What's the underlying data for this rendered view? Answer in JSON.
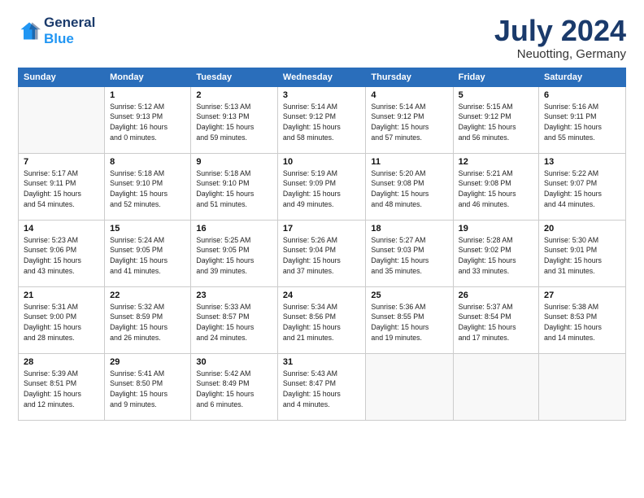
{
  "header": {
    "logo_line1": "General",
    "logo_line2": "Blue",
    "month": "July 2024",
    "location": "Neuotting, Germany"
  },
  "columns": [
    "Sunday",
    "Monday",
    "Tuesday",
    "Wednesday",
    "Thursday",
    "Friday",
    "Saturday"
  ],
  "weeks": [
    [
      {
        "day": "",
        "info": ""
      },
      {
        "day": "1",
        "info": "Sunrise: 5:12 AM\nSunset: 9:13 PM\nDaylight: 16 hours\nand 0 minutes."
      },
      {
        "day": "2",
        "info": "Sunrise: 5:13 AM\nSunset: 9:13 PM\nDaylight: 15 hours\nand 59 minutes."
      },
      {
        "day": "3",
        "info": "Sunrise: 5:14 AM\nSunset: 9:12 PM\nDaylight: 15 hours\nand 58 minutes."
      },
      {
        "day": "4",
        "info": "Sunrise: 5:14 AM\nSunset: 9:12 PM\nDaylight: 15 hours\nand 57 minutes."
      },
      {
        "day": "5",
        "info": "Sunrise: 5:15 AM\nSunset: 9:12 PM\nDaylight: 15 hours\nand 56 minutes."
      },
      {
        "day": "6",
        "info": "Sunrise: 5:16 AM\nSunset: 9:11 PM\nDaylight: 15 hours\nand 55 minutes."
      }
    ],
    [
      {
        "day": "7",
        "info": "Sunrise: 5:17 AM\nSunset: 9:11 PM\nDaylight: 15 hours\nand 54 minutes."
      },
      {
        "day": "8",
        "info": "Sunrise: 5:18 AM\nSunset: 9:10 PM\nDaylight: 15 hours\nand 52 minutes."
      },
      {
        "day": "9",
        "info": "Sunrise: 5:18 AM\nSunset: 9:10 PM\nDaylight: 15 hours\nand 51 minutes."
      },
      {
        "day": "10",
        "info": "Sunrise: 5:19 AM\nSunset: 9:09 PM\nDaylight: 15 hours\nand 49 minutes."
      },
      {
        "day": "11",
        "info": "Sunrise: 5:20 AM\nSunset: 9:08 PM\nDaylight: 15 hours\nand 48 minutes."
      },
      {
        "day": "12",
        "info": "Sunrise: 5:21 AM\nSunset: 9:08 PM\nDaylight: 15 hours\nand 46 minutes."
      },
      {
        "day": "13",
        "info": "Sunrise: 5:22 AM\nSunset: 9:07 PM\nDaylight: 15 hours\nand 44 minutes."
      }
    ],
    [
      {
        "day": "14",
        "info": "Sunrise: 5:23 AM\nSunset: 9:06 PM\nDaylight: 15 hours\nand 43 minutes."
      },
      {
        "day": "15",
        "info": "Sunrise: 5:24 AM\nSunset: 9:05 PM\nDaylight: 15 hours\nand 41 minutes."
      },
      {
        "day": "16",
        "info": "Sunrise: 5:25 AM\nSunset: 9:05 PM\nDaylight: 15 hours\nand 39 minutes."
      },
      {
        "day": "17",
        "info": "Sunrise: 5:26 AM\nSunset: 9:04 PM\nDaylight: 15 hours\nand 37 minutes."
      },
      {
        "day": "18",
        "info": "Sunrise: 5:27 AM\nSunset: 9:03 PM\nDaylight: 15 hours\nand 35 minutes."
      },
      {
        "day": "19",
        "info": "Sunrise: 5:28 AM\nSunset: 9:02 PM\nDaylight: 15 hours\nand 33 minutes."
      },
      {
        "day": "20",
        "info": "Sunrise: 5:30 AM\nSunset: 9:01 PM\nDaylight: 15 hours\nand 31 minutes."
      }
    ],
    [
      {
        "day": "21",
        "info": "Sunrise: 5:31 AM\nSunset: 9:00 PM\nDaylight: 15 hours\nand 28 minutes."
      },
      {
        "day": "22",
        "info": "Sunrise: 5:32 AM\nSunset: 8:59 PM\nDaylight: 15 hours\nand 26 minutes."
      },
      {
        "day": "23",
        "info": "Sunrise: 5:33 AM\nSunset: 8:57 PM\nDaylight: 15 hours\nand 24 minutes."
      },
      {
        "day": "24",
        "info": "Sunrise: 5:34 AM\nSunset: 8:56 PM\nDaylight: 15 hours\nand 21 minutes."
      },
      {
        "day": "25",
        "info": "Sunrise: 5:36 AM\nSunset: 8:55 PM\nDaylight: 15 hours\nand 19 minutes."
      },
      {
        "day": "26",
        "info": "Sunrise: 5:37 AM\nSunset: 8:54 PM\nDaylight: 15 hours\nand 17 minutes."
      },
      {
        "day": "27",
        "info": "Sunrise: 5:38 AM\nSunset: 8:53 PM\nDaylight: 15 hours\nand 14 minutes."
      }
    ],
    [
      {
        "day": "28",
        "info": "Sunrise: 5:39 AM\nSunset: 8:51 PM\nDaylight: 15 hours\nand 12 minutes."
      },
      {
        "day": "29",
        "info": "Sunrise: 5:41 AM\nSunset: 8:50 PM\nDaylight: 15 hours\nand 9 minutes."
      },
      {
        "day": "30",
        "info": "Sunrise: 5:42 AM\nSunset: 8:49 PM\nDaylight: 15 hours\nand 6 minutes."
      },
      {
        "day": "31",
        "info": "Sunrise: 5:43 AM\nSunset: 8:47 PM\nDaylight: 15 hours\nand 4 minutes."
      },
      {
        "day": "",
        "info": ""
      },
      {
        "day": "",
        "info": ""
      },
      {
        "day": "",
        "info": ""
      }
    ]
  ]
}
